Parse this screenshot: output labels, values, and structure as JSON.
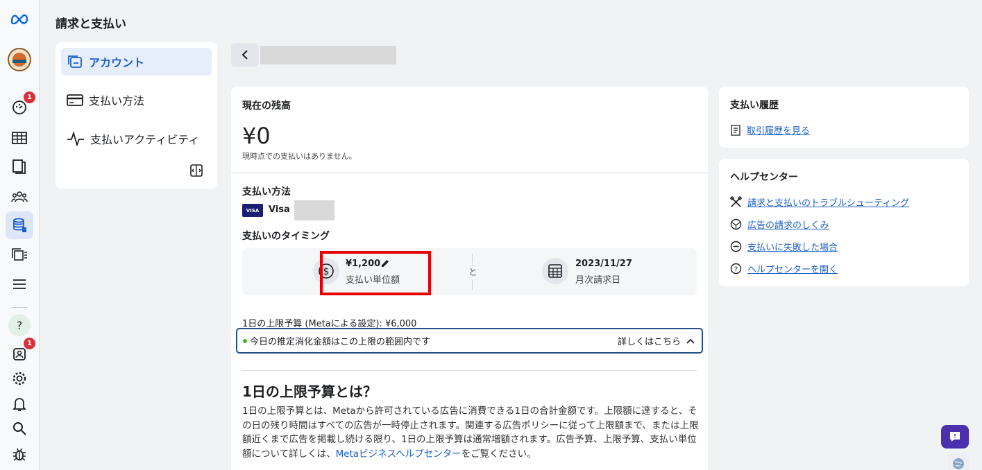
{
  "header": {
    "title": "請求と支払い"
  },
  "rail": {
    "badge_notifications": "1",
    "badge_alerts": "1"
  },
  "nav": {
    "items": [
      {
        "label": "アカウント"
      },
      {
        "label": "支払い方法"
      },
      {
        "label": "支払いアクティビティ"
      }
    ]
  },
  "balance": {
    "title": "現在の残高",
    "amount": "¥0",
    "note": "現時点での支払いはありません。"
  },
  "payment_method": {
    "title": "支払い方法",
    "card_brand_logo": "VISA",
    "card_label": "Visa •"
  },
  "timing": {
    "title": "支払いのタイミング",
    "threshold_value": "¥1,200",
    "threshold_label": "支払い単位額",
    "connector": "と",
    "billing_date": "2023/11/27",
    "billing_label": "月次請求日"
  },
  "daily_limit": {
    "text": "1日の上限予算 (Metaによる設定): ¥6,000",
    "status": "今日の推定消化金額はこの上限の範囲内です",
    "details_label": "詳しくはこちら"
  },
  "explainer": {
    "heading": "1日の上限予算とは？",
    "body_1": "1日の上限予算とは、Metaから許可されている広告に消費できる1日の合計金額です。上限額に達すると、その日の残り時間はすべての広告が一時停止されます。関連する広告ポリシーに従って上限額まで、または上限額近くまで広告を掲載し続ける限り、1日の上限予算は通常増額されます。広告予算、上限予算、支払い単位額について詳しくは、",
    "link": "Metaビジネスヘルプセンター",
    "body_2": "をご覧ください。"
  },
  "history": {
    "title": "支払い履歴",
    "link": "取引履歴を見る"
  },
  "help": {
    "title": "ヘルプセンター",
    "links": [
      "請求と支払いのトラブルシューティング",
      "広告の請求のしくみ",
      "支払いに失敗した場合",
      "ヘルプセンターを開く"
    ]
  },
  "colors": {
    "accent": "#1b5fc9",
    "highlight": "#e60000",
    "badge": "#d7303a",
    "chat": "#4b2fae"
  }
}
